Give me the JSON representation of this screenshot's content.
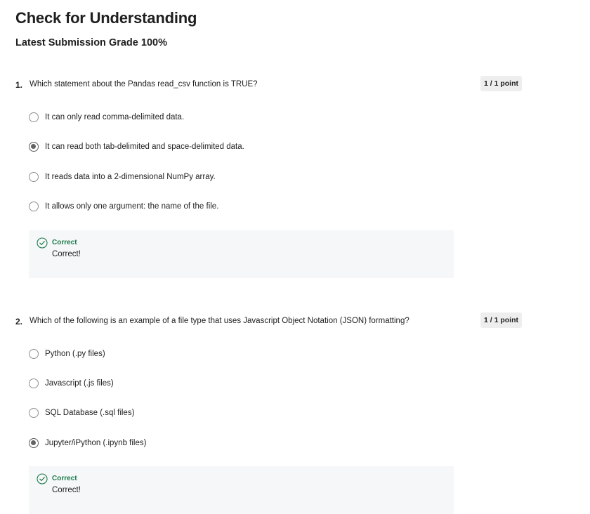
{
  "page": {
    "title": "Check for Understanding",
    "grade_label": "Latest Submission Grade 100%"
  },
  "questions": [
    {
      "number": "1.",
      "text": "Which statement about the Pandas read_csv function is TRUE?",
      "points": "1 / 1 point",
      "options": [
        {
          "label": "It can only read comma-delimited data.",
          "selected": false
        },
        {
          "label": "It can read both tab-delimited and space-delimited data.",
          "selected": true
        },
        {
          "label": "It reads data into a 2-dimensional NumPy array.",
          "selected": false
        },
        {
          "label": "It allows only one argument: the name of the file.",
          "selected": false
        }
      ],
      "feedback": {
        "status": "Correct",
        "message": "Correct!"
      }
    },
    {
      "number": "2.",
      "text": "Which of the following is an example of a file type that uses Javascript Object Notation (JSON) formatting?",
      "points": "1 / 1 point",
      "options": [
        {
          "label": "Python (.py files)",
          "selected": false
        },
        {
          "label": "Javascript (.js files)",
          "selected": false
        },
        {
          "label": "SQL Database (.sql files)",
          "selected": false
        },
        {
          "label": "Jupyter/iPython (.ipynb files)",
          "selected": true
        }
      ],
      "feedback": {
        "status": "Correct",
        "message": "Correct!"
      }
    }
  ],
  "colors": {
    "correct_green": "#1e7a4c",
    "feedback_bg": "#f5f7f8",
    "badge_bg": "#eeeeee",
    "radio_border": "#8f8f8f",
    "radio_fill": "#636363"
  },
  "icons": {
    "feedback": "check-circle-icon"
  }
}
